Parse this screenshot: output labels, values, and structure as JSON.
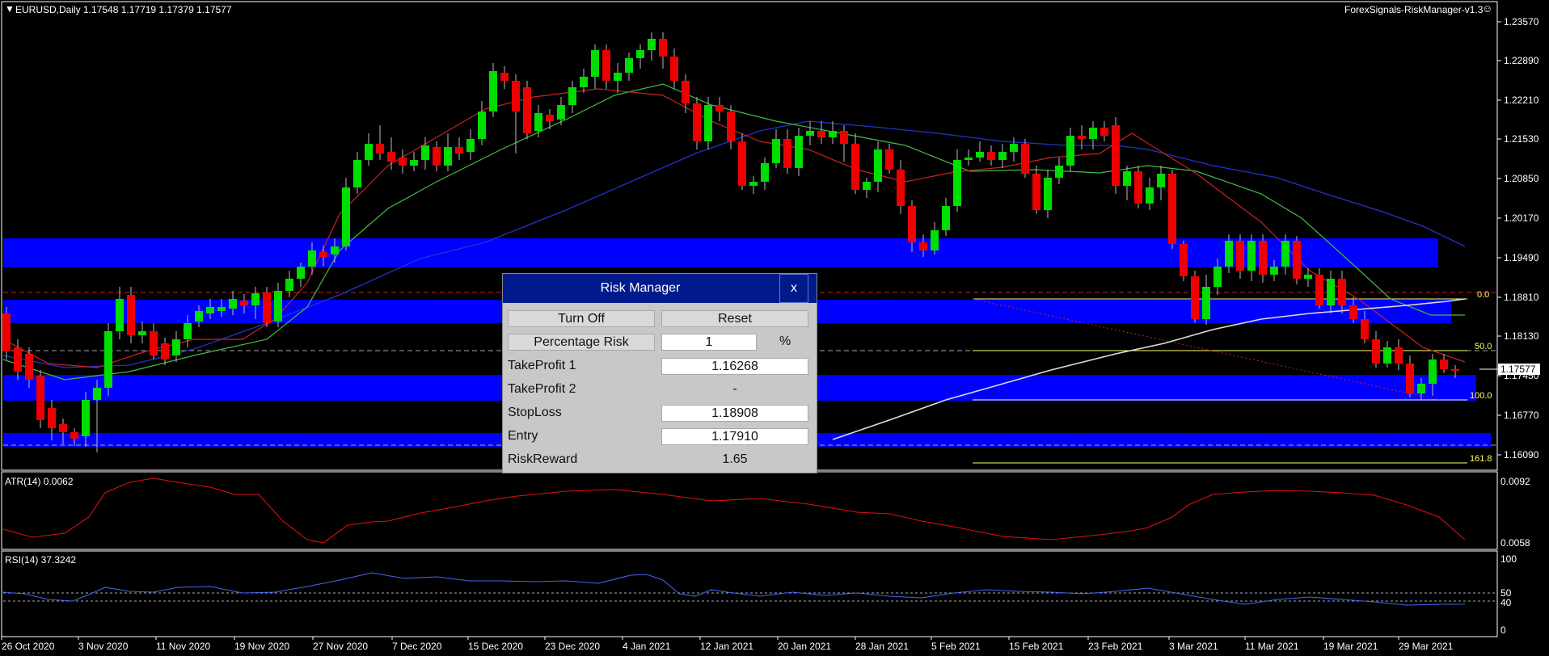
{
  "header": {
    "symbol_info": "EURUSD,Daily  1.17548 1.17719 1.17379 1.17577",
    "indicator_name": "ForexSignals-RiskManager-v1.3",
    "smiley_icon": "smiley-face-icon"
  },
  "price_axis": {
    "labels": [
      "1.23570",
      "1.22890",
      "1.22210",
      "1.21530",
      "1.20850",
      "1.20170",
      "1.19490",
      "1.18810",
      "1.18130",
      "1.17450",
      "1.16770",
      "1.16090"
    ],
    "current_price": "1.17577"
  },
  "fib_labels": [
    "0.0",
    "50.0",
    "100.0",
    "161.8"
  ],
  "atr": {
    "title": "ATR(14) 0.0062",
    "axis": [
      "0.0092",
      "0.0058"
    ]
  },
  "rsi": {
    "title": "RSI(14) 37.3242",
    "axis": [
      "100",
      "50",
      "40",
      "0"
    ]
  },
  "time_axis": [
    "26 Oct 2020",
    "3 Nov 2020",
    "11 Nov 2020",
    "19 Nov 2020",
    "27 Nov 2020",
    "7 Dec 2020",
    "15 Dec 2020",
    "23 Dec 2020",
    "4 Jan 2021",
    "12 Jan 2021",
    "20 Jan 2021",
    "28 Jan 2021",
    "5 Feb 2021",
    "15 Feb 2021",
    "23 Feb 2021",
    "3 Mar 2021",
    "11 Mar 2021",
    "19 Mar 2021",
    "29 Mar 2021"
  ],
  "colors": {
    "bull": "#00dd00",
    "bear": "#ee0000",
    "zone": "#0000ff",
    "fib": "#ffff66",
    "atr": "#dd1111",
    "rsi": "#4466ee"
  },
  "risk_manager": {
    "title": "Risk Manager",
    "close_label": "x",
    "turn_off_label": "Turn Off",
    "reset_label": "Reset",
    "percentage_risk_label": "Percentage Risk",
    "percentage_risk_value": "1",
    "percent_sign": "%",
    "takeprofit1_label": "TakeProfit 1",
    "takeprofit1_value": "1.16268",
    "takeprofit2_label": "TakeProfit 2",
    "takeprofit2_value": "-",
    "stoploss_label": "StopLoss",
    "stoploss_value": "1.18908",
    "entry_label": "Entry",
    "entry_value": "1.17910",
    "riskreward_label": "RiskReward",
    "riskreward_value": "1.65"
  }
}
